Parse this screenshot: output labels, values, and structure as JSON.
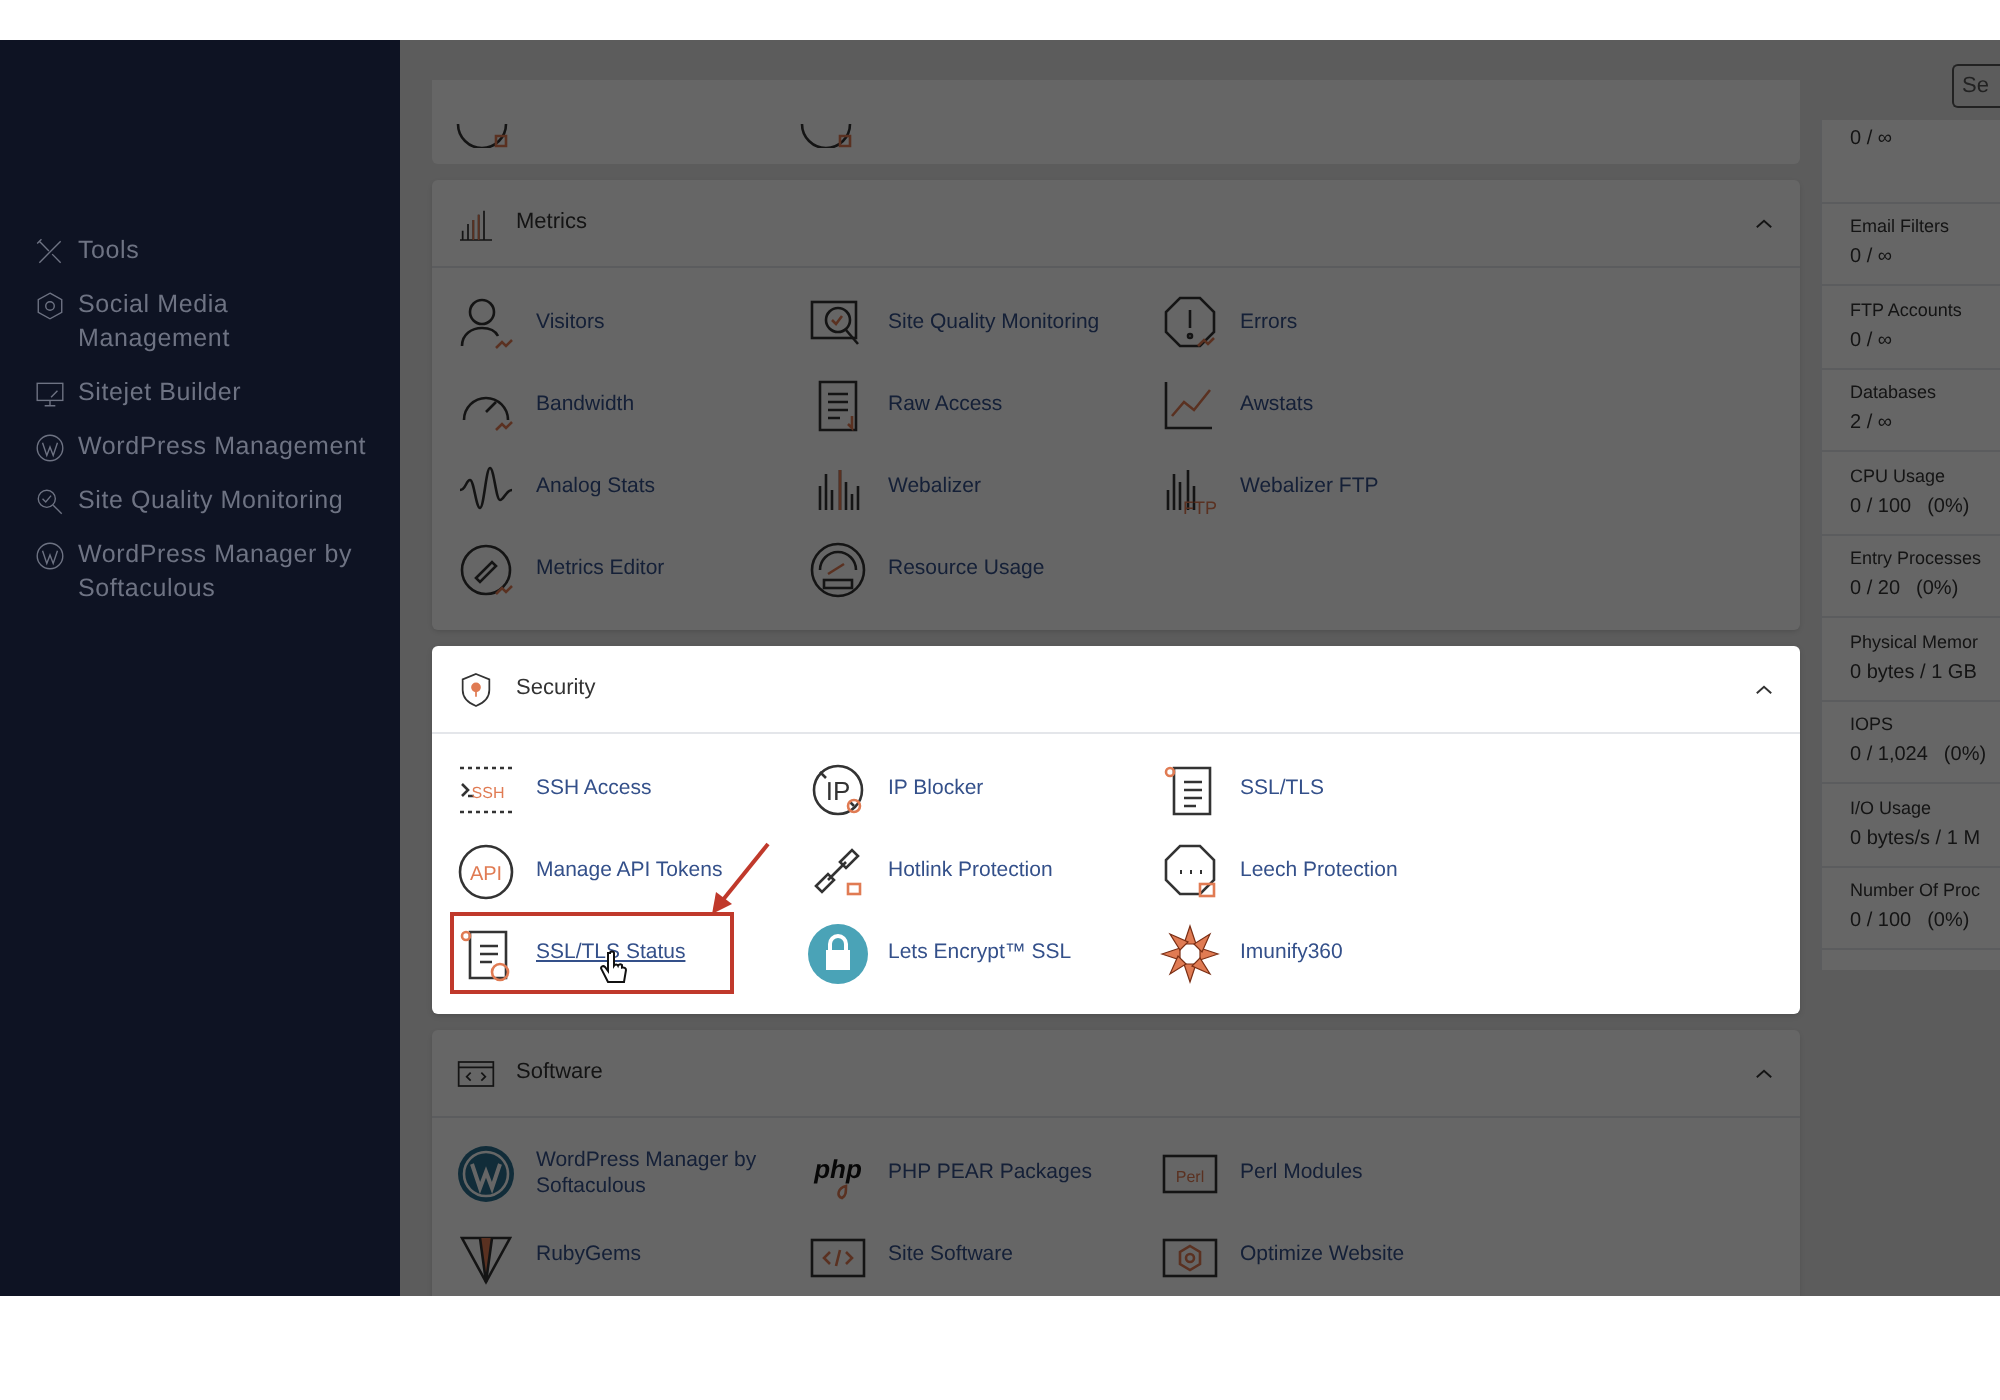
{
  "dim_background": true,
  "sidebar": {
    "items": [
      {
        "label": "Tools"
      },
      {
        "label": "Social Media Management"
      },
      {
        "label": "Sitejet Builder"
      },
      {
        "label": "WordPress Management"
      },
      {
        "label": "Site Quality Monitoring"
      },
      {
        "label": "WordPress Manager by Softaculous"
      }
    ]
  },
  "search": {
    "value": "Se"
  },
  "sections": [
    {
      "title": "Metrics",
      "dimmed": true,
      "items": [
        {
          "label": "Visitors"
        },
        {
          "label": "Site Quality Monitoring"
        },
        {
          "label": "Errors"
        },
        {
          "label": "Bandwidth"
        },
        {
          "label": "Raw Access"
        },
        {
          "label": "Awstats"
        },
        {
          "label": "Analog Stats"
        },
        {
          "label": "Webalizer"
        },
        {
          "label": "Webalizer FTP",
          "icon_text": "FTP"
        },
        {
          "label": "Metrics Editor"
        },
        {
          "label": "Resource Usage"
        }
      ]
    },
    {
      "title": "Security",
      "dimmed": false,
      "items": [
        {
          "label": "SSH Access",
          "icon_text": "SSH",
          "highlighted": false
        },
        {
          "label": "IP Blocker",
          "icon_text": "IP",
          "highlighted": false
        },
        {
          "label": "SSL/TLS",
          "highlighted": false
        },
        {
          "label": "Manage API Tokens",
          "icon_text": "API",
          "highlighted": false
        },
        {
          "label": "Hotlink Protection",
          "highlighted": false
        },
        {
          "label": "Leech Protection",
          "highlighted": false
        },
        {
          "label": "SSL/TLS Status",
          "highlighted": true
        },
        {
          "label": "Lets Encrypt™ SSL",
          "highlighted": false
        },
        {
          "label": "Imunify360",
          "highlighted": false
        }
      ]
    },
    {
      "title": "Software",
      "dimmed": true,
      "items": [
        {
          "label": "WordPress Manager by Softaculous"
        },
        {
          "label": "PHP PEAR Packages",
          "icon_text": "php"
        },
        {
          "label": "Perl Modules",
          "icon_text": "Perl"
        },
        {
          "label": "RubyGems"
        },
        {
          "label": "Site Software"
        },
        {
          "label": "Optimize Website"
        }
      ]
    }
  ],
  "stats": [
    {
      "value": "0 / ∞"
    },
    {
      "label": "Email Filters",
      "value": "0 / ∞"
    },
    {
      "label": "FTP Accounts",
      "value": "0 / ∞"
    },
    {
      "label": "Databases",
      "value": "2 / ∞"
    },
    {
      "label": "CPU Usage",
      "value": "0 / 100",
      "percent": "(0%)"
    },
    {
      "label": "Entry Processes",
      "value": "0 / 20",
      "percent": "(0%)"
    },
    {
      "label": "Physical Memor",
      "value": "0 bytes / 1 GB"
    },
    {
      "label": "IOPS",
      "value": "0 / 1,024",
      "percent": "(0%)"
    },
    {
      "label": "I/O Usage",
      "value": "0 bytes/s / 1 M"
    },
    {
      "label": "Number Of Proc",
      "value": "0 / 100",
      "percent": "(0%)"
    }
  ]
}
